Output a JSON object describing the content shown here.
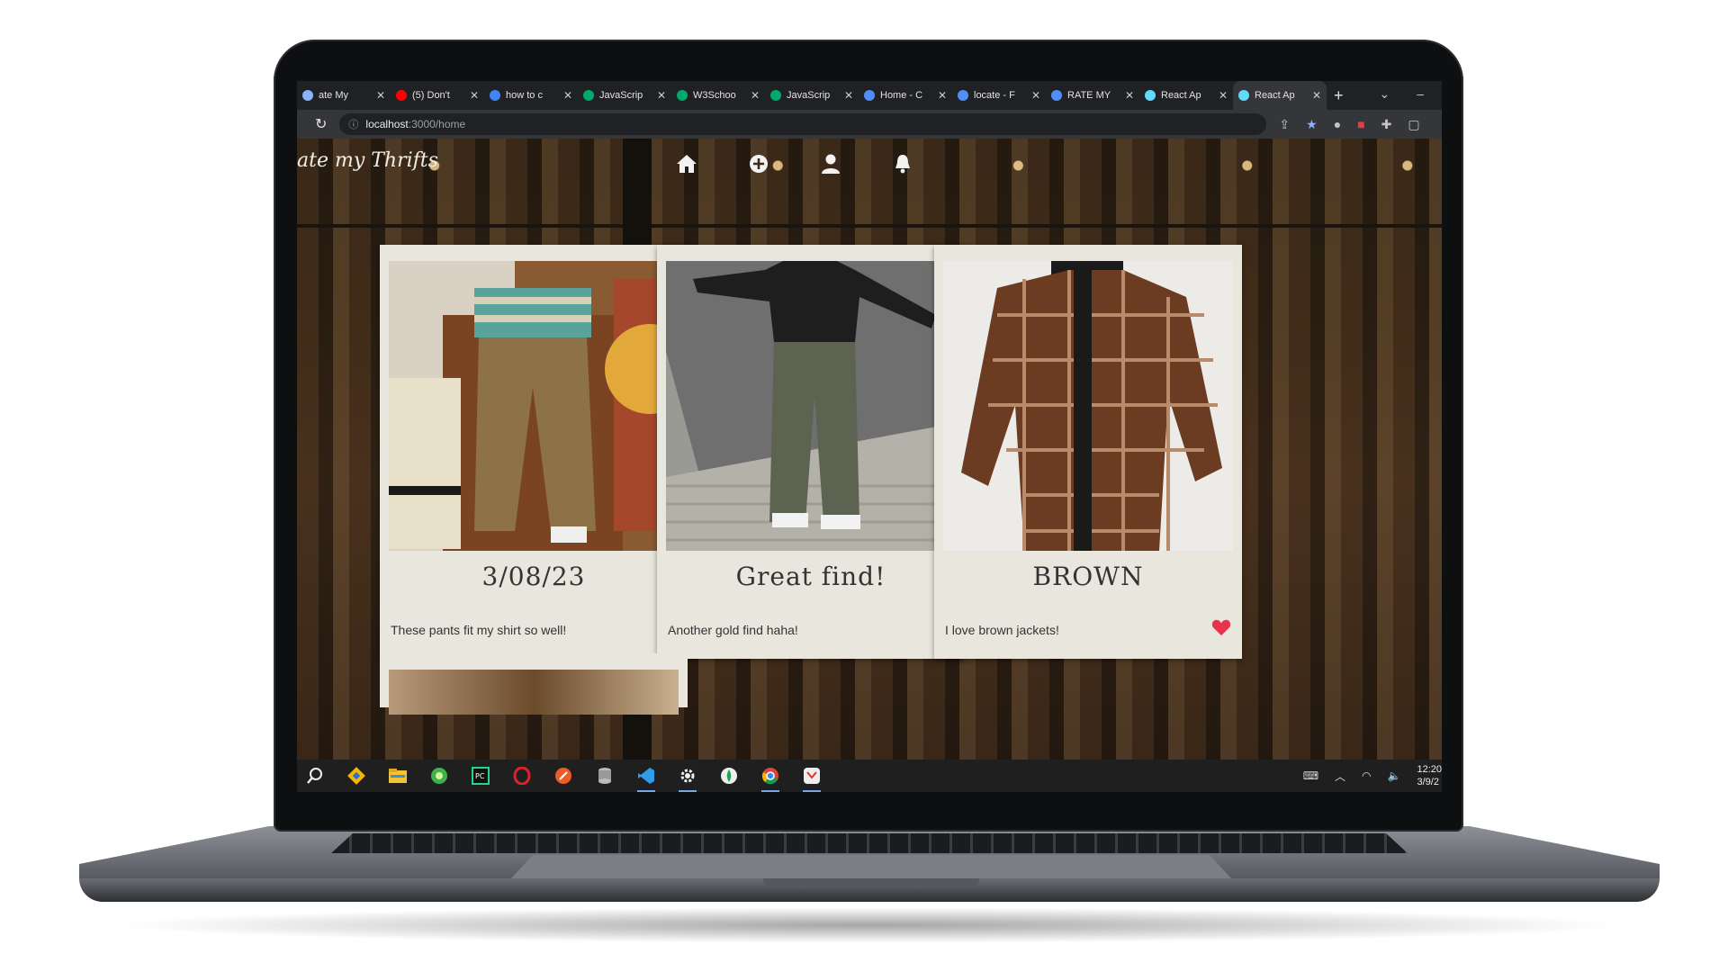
{
  "browser": {
    "tabs": [
      {
        "label": "ate My",
        "favicon": "generic",
        "color": "#8ab4f8"
      },
      {
        "label": "(5) Don't",
        "favicon": "youtube",
        "color": "#ff0000"
      },
      {
        "label": "how to c",
        "favicon": "google",
        "color": "#4285f4"
      },
      {
        "label": "JavaScrip",
        "favicon": "w3schools",
        "color": "#04aa6d"
      },
      {
        "label": "W3Schoo",
        "favicon": "w3schools",
        "color": "#04aa6d"
      },
      {
        "label": "JavaScrip",
        "favicon": "w3schools",
        "color": "#04aa6d"
      },
      {
        "label": "Home - C",
        "favicon": "c-circle",
        "color": "#4f8ff7"
      },
      {
        "label": "locate - F",
        "favicon": "c-circle",
        "color": "#4f8ff7"
      },
      {
        "label": "RATE MY",
        "favicon": "c-circle",
        "color": "#4f8ff7"
      },
      {
        "label": "React Ap",
        "favicon": "react",
        "color": "#61dafb"
      },
      {
        "label": "React Ap",
        "favicon": "react",
        "color": "#61dafb"
      }
    ],
    "active_tab": 10,
    "close_glyph": "✕",
    "new_tab_glyph": "+",
    "url_host": "localhost",
    "url_path": ":3000/home"
  },
  "app": {
    "brand": "ate my Thrifts",
    "nav": [
      "home-icon",
      "add-circle-icon",
      "user-icon",
      "bell-icon"
    ]
  },
  "cards": [
    {
      "title": "3/08/23",
      "caption": "These pants fit my shirt so well!",
      "liked": false
    },
    {
      "title": "Great find!",
      "caption": "Another gold find haha!",
      "liked": true
    },
    {
      "title": "BROWN",
      "caption": "I love brown jackets!",
      "liked": true
    }
  ],
  "colors": {
    "heart_default": "#2a2a2a",
    "heart_liked": "#e8324e"
  },
  "taskbar": {
    "time": "12:20",
    "date": "3/9/2"
  }
}
